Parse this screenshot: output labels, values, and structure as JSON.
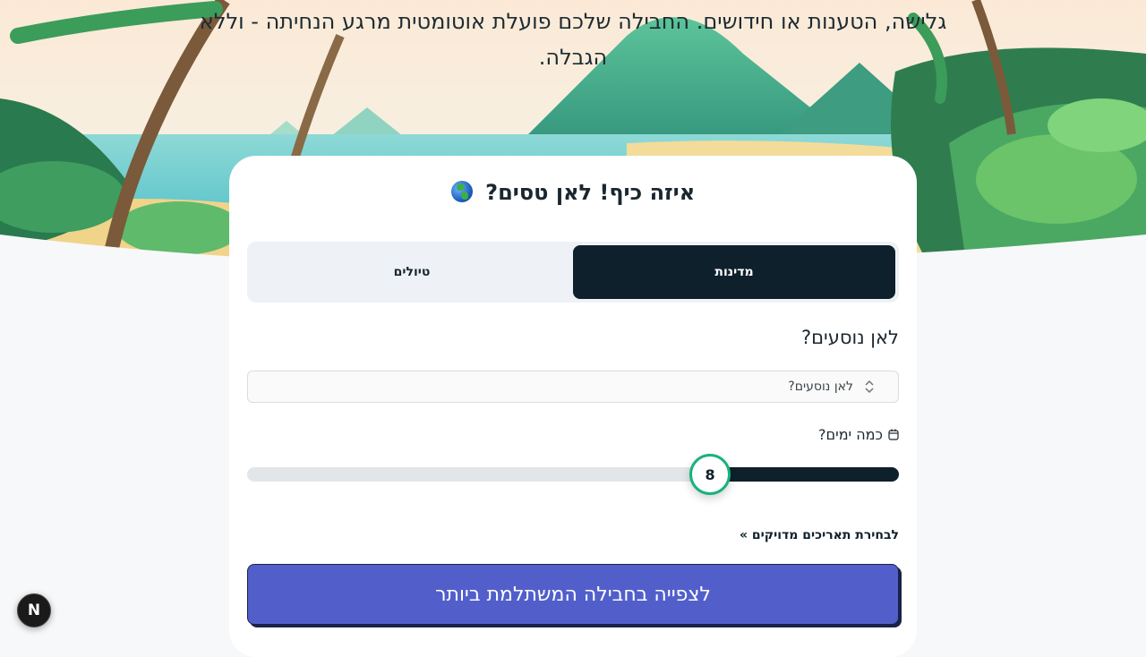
{
  "hero": {
    "text": "גלישה, הטענות או חידושים. החבילה שלכם פועלת אוטומטית מרגע הנחיתה - וללא הגבלה."
  },
  "card": {
    "title": "איזה כיף! לאן טסים?",
    "title_icon": "globe-icon"
  },
  "tabs": [
    {
      "label": "מדינות",
      "active": true
    },
    {
      "label": "טיולים",
      "active": false
    }
  ],
  "destination": {
    "label": "לאן נוסעים?",
    "select_value": "לאן נוסעים?",
    "icon": "chevron-up-down-icon"
  },
  "days": {
    "label": "כמה ימים?",
    "icon": "calendar-icon",
    "value": "8",
    "fill_fraction": 0.29
  },
  "links": {
    "exact_dates": "לבחירת תאריכים מדויקים »"
  },
  "cta": {
    "label": "לצפייה בחבילה המשתלמת ביותר",
    "color": "#525fcb"
  },
  "dev_badge": {
    "label": "N"
  }
}
